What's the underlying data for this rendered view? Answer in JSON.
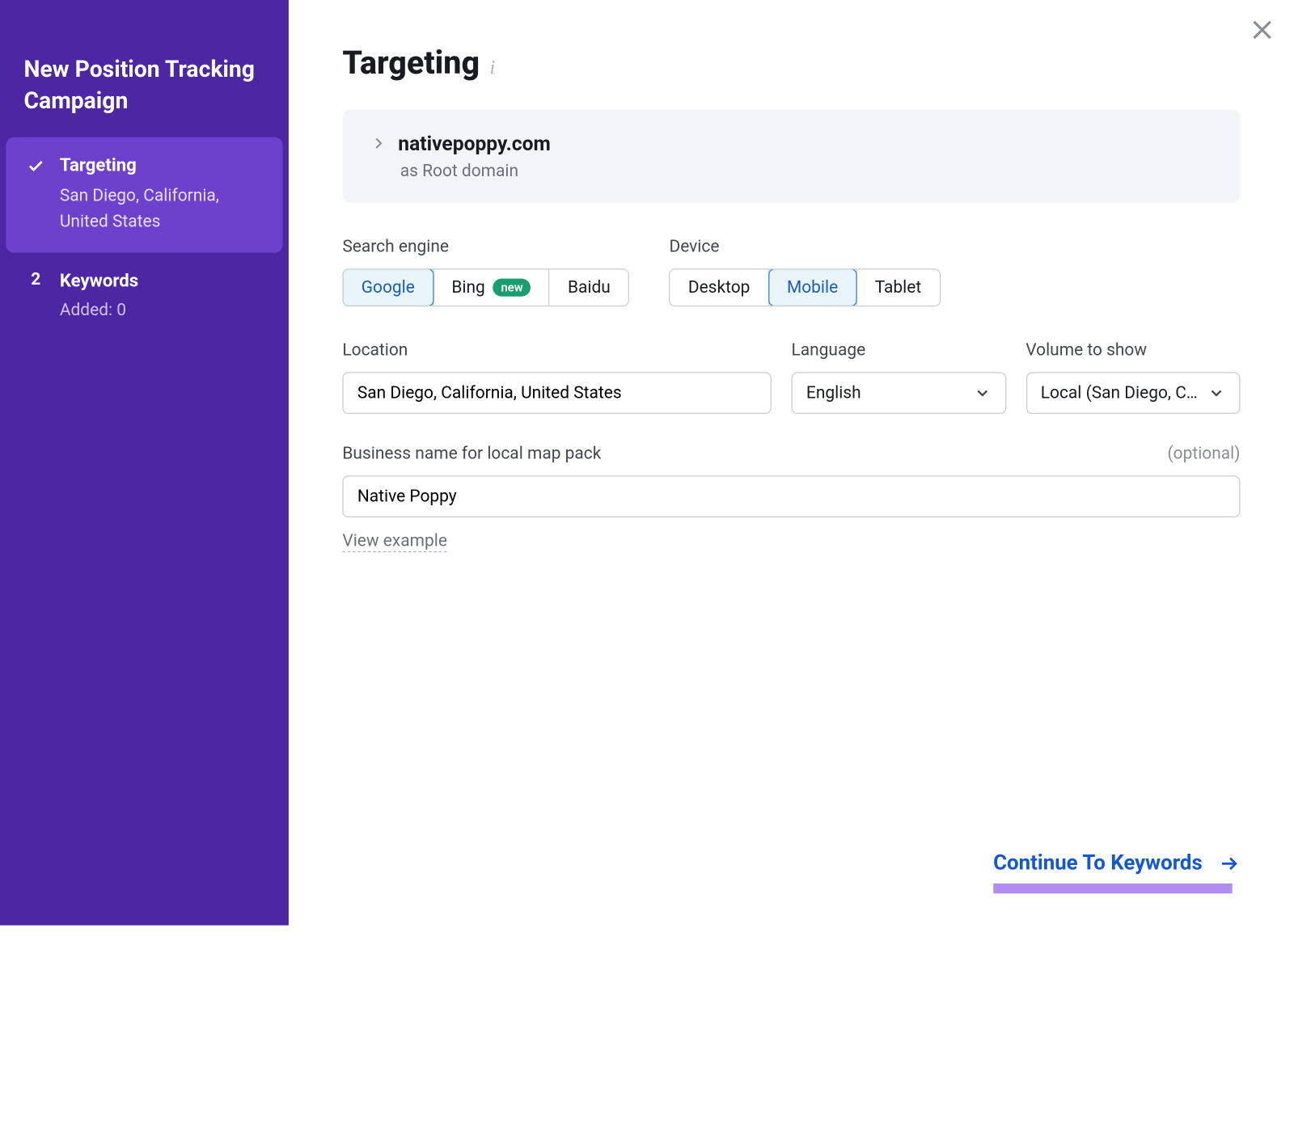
{
  "sidebar": {
    "title": "New Position Tracking Campaign",
    "steps": [
      {
        "label": "Targeting",
        "sub": "San Diego, California, United States",
        "done": true
      },
      {
        "num": "2",
        "label": "Keywords",
        "sub": "Added: 0"
      }
    ]
  },
  "header": {
    "title": "Targeting"
  },
  "domain": {
    "name": "nativepoppy.com",
    "sub": "as Root domain"
  },
  "search_engine": {
    "label": "Search engine",
    "options": [
      "Google",
      "Bing",
      "Baidu"
    ],
    "new_badge": "new",
    "selected": "Google"
  },
  "device": {
    "label": "Device",
    "options": [
      "Desktop",
      "Mobile",
      "Tablet"
    ],
    "selected": "Mobile"
  },
  "location": {
    "label": "Location",
    "value": "San Diego, California, United States"
  },
  "language": {
    "label": "Language",
    "value": "English"
  },
  "volume": {
    "label": "Volume to show",
    "value": "Local (San Diego, C…"
  },
  "business": {
    "label": "Business name for local map pack",
    "optional": "(optional)",
    "value": "Native Poppy",
    "example": "View example"
  },
  "footer": {
    "continue": "Continue To Keywords"
  }
}
